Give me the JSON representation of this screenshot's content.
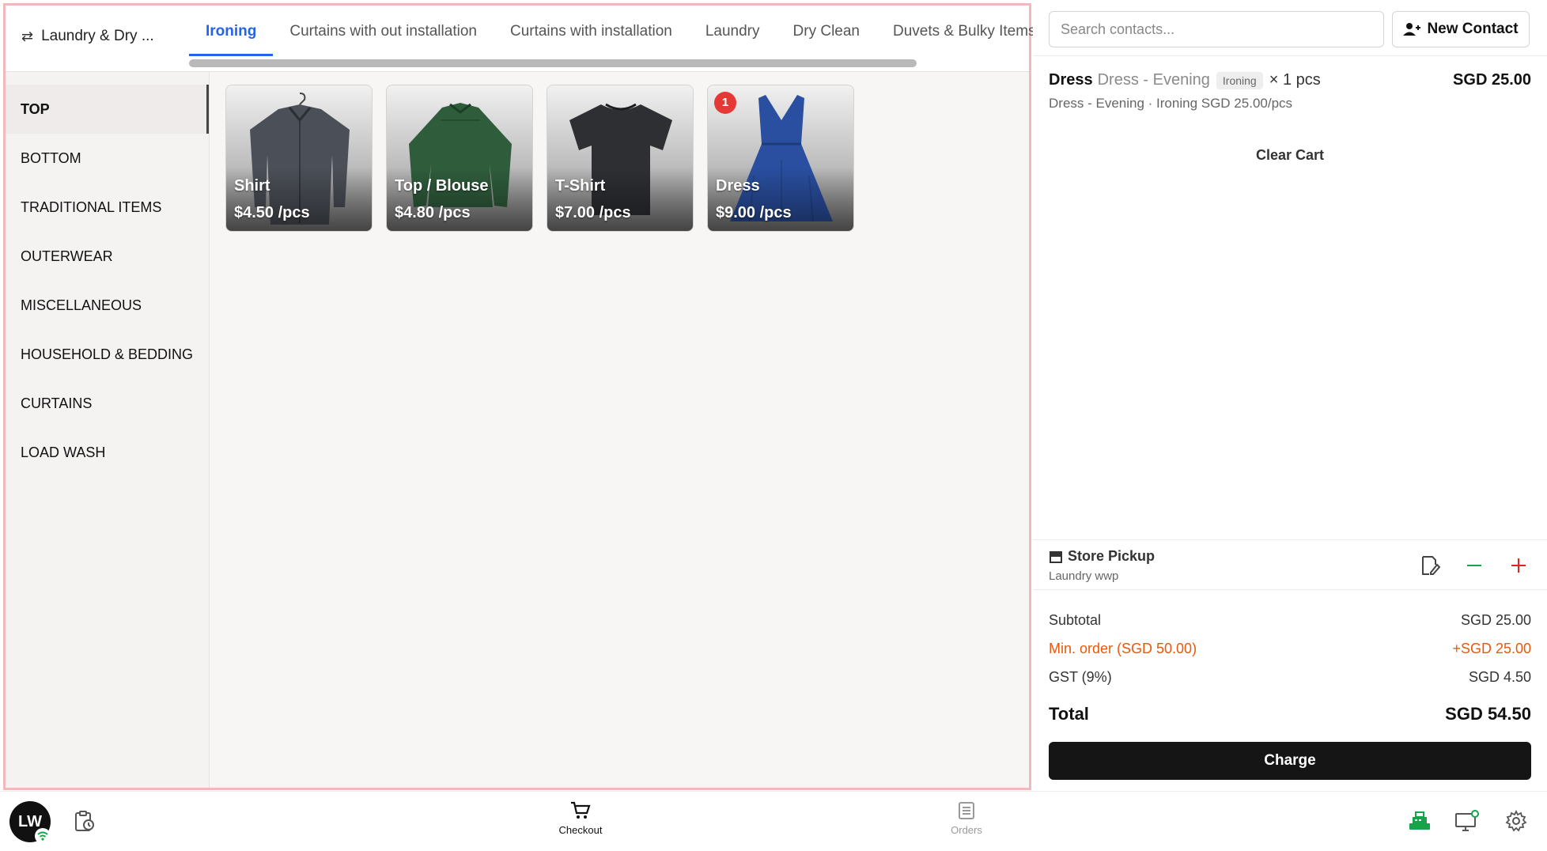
{
  "header": {
    "service_switch_label": "Laundry & Dry ...",
    "tabs": [
      {
        "label": "Ironing",
        "active": true
      },
      {
        "label": "Curtains with out installation"
      },
      {
        "label": "Curtains with installation"
      },
      {
        "label": "Laundry"
      },
      {
        "label": "Dry Clean"
      },
      {
        "label": "Duvets & Bulky Items"
      }
    ]
  },
  "categories": [
    {
      "label": "TOP",
      "active": true
    },
    {
      "label": "BOTTOM"
    },
    {
      "label": "TRADITIONAL ITEMS"
    },
    {
      "label": "OUTERWEAR"
    },
    {
      "label": "MISCELLANEOUS"
    },
    {
      "label": "HOUSEHOLD & BEDDING"
    },
    {
      "label": "CURTAINS"
    },
    {
      "label": "LOAD WASH"
    }
  ],
  "products": [
    {
      "name": "Shirt",
      "price": "$4.50 /pcs",
      "image": "shirt-image",
      "color": "#4b4f57"
    },
    {
      "name": "Top / Blouse",
      "price": "$4.80 /pcs",
      "image": "blouse-image",
      "color": "#2f5d3c"
    },
    {
      "name": "T-Shirt",
      "price": "$7.00 /pcs",
      "image": "tshirt-image",
      "color": "#2e2f33"
    },
    {
      "name": "Dress",
      "price": "$9.00 /pcs",
      "image": "dress-image",
      "color": "#2a4fa0",
      "badge": "1"
    }
  ],
  "contacts": {
    "search_placeholder": "Search contacts...",
    "new_contact_label": "New Contact"
  },
  "cart": {
    "items": [
      {
        "name": "Dress",
        "variant": "Dress - Evening",
        "service_tag": "Ironing",
        "qty": "× 1 pcs",
        "price": "SGD 25.00",
        "detail": "Dress - Evening · Ironing SGD 25.00/pcs"
      }
    ],
    "clear_label": "Clear Cart"
  },
  "pickup": {
    "title": "Store Pickup",
    "subtitle": "Laundry wwp"
  },
  "totals": {
    "subtotal_label": "Subtotal",
    "subtotal_value": "SGD 25.00",
    "min_order_label": "Min. order (SGD 50.00)",
    "min_order_value": "+SGD 25.00",
    "gst_label": "GST (9%)",
    "gst_value": "SGD 4.50",
    "total_label": "Total",
    "total_value": "SGD 54.50",
    "charge_label": "Charge"
  },
  "bottom_nav": {
    "avatar_initials": "LW",
    "checkout_label": "Checkout",
    "orders_label": "Orders"
  },
  "colors": {
    "accent": "#2563eb",
    "warning": "#e8590c",
    "badge": "#e53935",
    "panel_border": "#f2b8bb",
    "online": "#16a34a"
  }
}
